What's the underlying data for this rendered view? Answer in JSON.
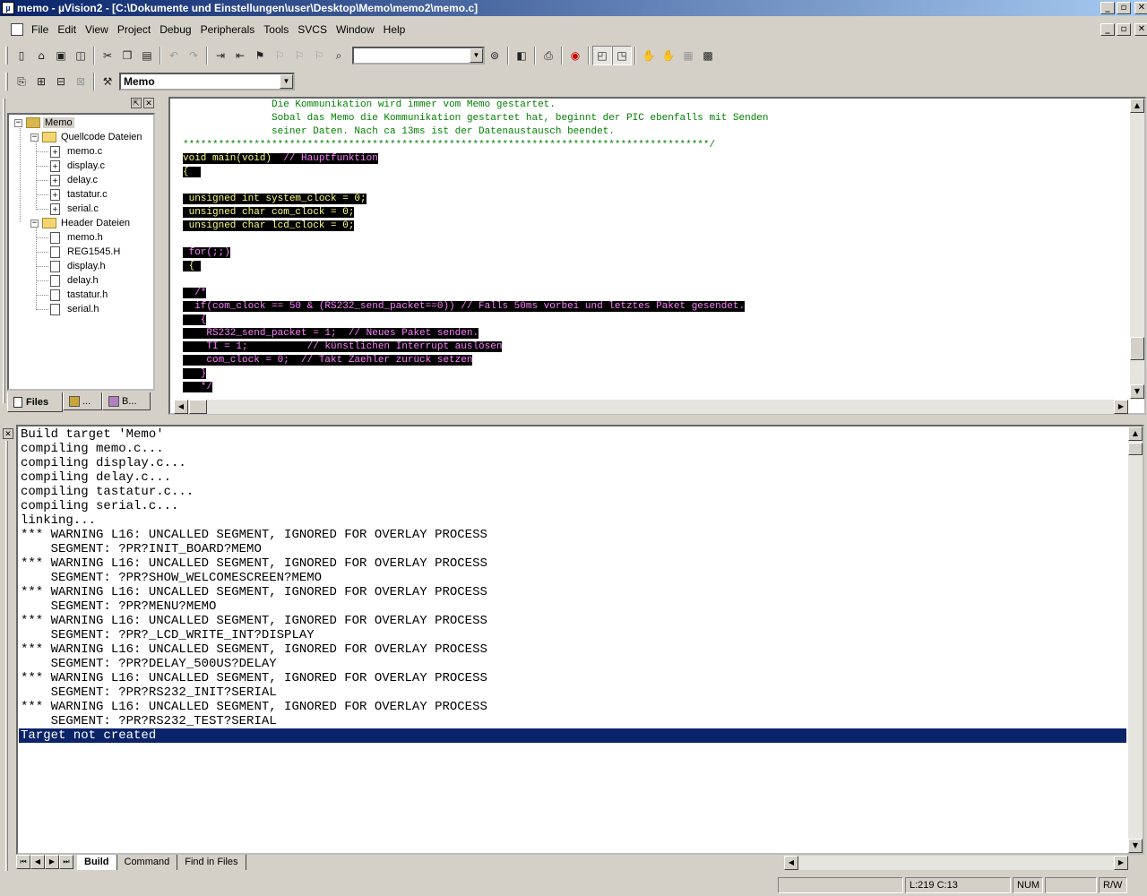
{
  "window": {
    "title": "memo - µVision2 - [C:\\Dokumente und Einstellungen\\user\\Desktop\\Memo\\memo2\\memo.c]"
  },
  "window_buttons": {
    "minimize": "_",
    "maximize": "▫",
    "close": "✕"
  },
  "menu": [
    "File",
    "Edit",
    "View",
    "Project",
    "Debug",
    "Peripherals",
    "Tools",
    "SVCS",
    "Window",
    "Help"
  ],
  "toolbar": {
    "find_combo_value": "",
    "target_combo_value": "Memo"
  },
  "project_tree": {
    "root": "Memo",
    "groups": [
      {
        "name": "Quellcode Dateien",
        "files": [
          "memo.c",
          "display.c",
          "delay.c",
          "tastatur.c",
          "serial.c"
        ]
      },
      {
        "name": "Header Dateien",
        "files": [
          "memo.h",
          "REG1545.H",
          "display.h",
          "delay.h",
          "tastatur.h",
          "serial.h"
        ]
      }
    ],
    "tabs": [
      "Files",
      "...",
      "B..."
    ]
  },
  "editor": {
    "lines": [
      {
        "t": "               Die Kommunikation wird immer vom Memo gestartet.",
        "c": "cg",
        "sel": false
      },
      {
        "t": "               Sobal das Memo die Kommunikation gestartet hat, beginnt der PIC ebenfalls mit Senden",
        "c": "cg",
        "sel": false
      },
      {
        "t": "               seiner Daten. Nach ca 13ms ist der Datenaustausch beendet.",
        "c": "cg",
        "sel": false
      },
      {
        "t": "*****************************************************************************************/",
        "c": "cg",
        "sel": false
      },
      {
        "t": "void main(void)  // Hauptfunktion",
        "c": "mix1",
        "sel": true
      },
      {
        "t": "{  ",
        "c": "cy",
        "sel": true
      },
      {
        "t": "",
        "c": "cy",
        "sel": false
      },
      {
        "t": " unsigned int system_clock = 0;",
        "c": "cy",
        "sel": true
      },
      {
        "t": " unsigned char com_clock = 0;",
        "c": "cy",
        "sel": true
      },
      {
        "t": " unsigned char lcd_clock = 0;",
        "c": "cy",
        "sel": true
      },
      {
        "t": "",
        "c": "cy",
        "sel": false
      },
      {
        "t": " for(;;)",
        "c": "cm",
        "sel": true
      },
      {
        "t": " { ",
        "c": "cy",
        "sel": true
      },
      {
        "t": "",
        "c": "cy",
        "sel": false
      },
      {
        "t": "  /*",
        "c": "cm",
        "sel": true
      },
      {
        "t": "  if(com_clock == 50 & (RS232_send_packet==0)) // Falls 50ms vorbei und letztes Paket gesendet.",
        "c": "cm",
        "sel": true
      },
      {
        "t": "   {",
        "c": "cm",
        "sel": true
      },
      {
        "t": "    RS232_send_packet = 1;  // Neues Paket senden.",
        "c": "cm",
        "sel": true
      },
      {
        "t": "    TI = 1;          // künstlichen Interrupt auslösen",
        "c": "cm",
        "sel": true
      },
      {
        "t": "    com_clock = 0;  // Takt Zaehler zurück setzen",
        "c": "cm",
        "sel": true
      },
      {
        "t": "   }",
        "c": "cm",
        "sel": true
      },
      {
        "t": "   */",
        "c": "cm",
        "sel": true
      }
    ]
  },
  "output": {
    "lines": [
      "Build target 'Memo'",
      "compiling memo.c...",
      "compiling display.c...",
      "compiling delay.c...",
      "compiling tastatur.c...",
      "compiling serial.c...",
      "linking...",
      "*** WARNING L16: UNCALLED SEGMENT, IGNORED FOR OVERLAY PROCESS",
      "    SEGMENT: ?PR?INIT_BOARD?MEMO",
      "*** WARNING L16: UNCALLED SEGMENT, IGNORED FOR OVERLAY PROCESS",
      "    SEGMENT: ?PR?SHOW_WELCOMESCREEN?MEMO",
      "*** WARNING L16: UNCALLED SEGMENT, IGNORED FOR OVERLAY PROCESS",
      "    SEGMENT: ?PR?MENU?MEMO",
      "*** WARNING L16: UNCALLED SEGMENT, IGNORED FOR OVERLAY PROCESS",
      "    SEGMENT: ?PR?_LCD_WRITE_INT?DISPLAY",
      "*** WARNING L16: UNCALLED SEGMENT, IGNORED FOR OVERLAY PROCESS",
      "    SEGMENT: ?PR?DELAY_500US?DELAY",
      "*** WARNING L16: UNCALLED SEGMENT, IGNORED FOR OVERLAY PROCESS",
      "    SEGMENT: ?PR?RS232_INIT?SERIAL",
      "*** WARNING L16: UNCALLED SEGMENT, IGNORED FOR OVERLAY PROCESS",
      "    SEGMENT: ?PR?RS232_TEST?SERIAL"
    ],
    "highlighted": "Target not created",
    "tabs": [
      "Build",
      "Command",
      "Find in Files"
    ]
  },
  "status": {
    "position": "L:219 C:13",
    "num": "NUM",
    "rw": "R/W"
  }
}
